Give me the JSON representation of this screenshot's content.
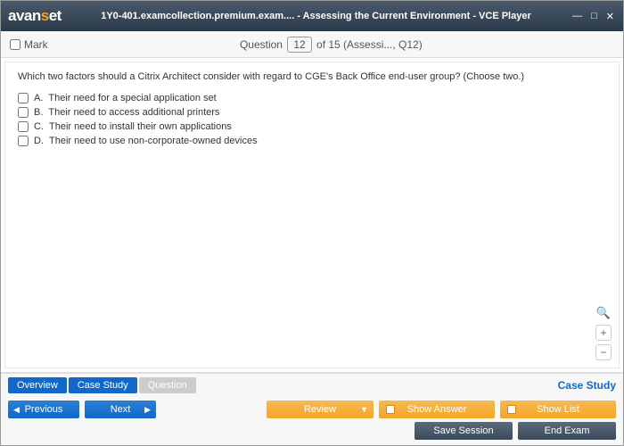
{
  "titlebar": {
    "logo_pre": "avan",
    "logo_mid": "s",
    "logo_post": "et",
    "title": "1Y0-401.examcollection.premium.exam.... - Assessing the Current Environment - VCE Player"
  },
  "header": {
    "mark": "Mark",
    "question_word": "Question",
    "current": "12",
    "of": " of 15 (Assessi..., Q12)"
  },
  "question": {
    "text": "Which two factors should a Citrix Architect consider with regard to CGE's Back Office end-user group? (Choose two.)",
    "options": [
      {
        "letter": "A.",
        "text": "Their need for a special application set"
      },
      {
        "letter": "B.",
        "text": "Their need to access additional printers"
      },
      {
        "letter": "C.",
        "text": "Their need to install their own applications"
      },
      {
        "letter": "D.",
        "text": "Their need to use non-corporate-owned devices"
      }
    ]
  },
  "tabs": {
    "overview": "Overview",
    "case_study": "Case Study",
    "question": "Question",
    "case_label": "Case Study"
  },
  "buttons": {
    "previous": "Previous",
    "next": "Next",
    "review": "Review",
    "show_answer": "Show Answer",
    "show_list": "Show List",
    "save_session": "Save Session",
    "end_exam": "End Exam"
  }
}
